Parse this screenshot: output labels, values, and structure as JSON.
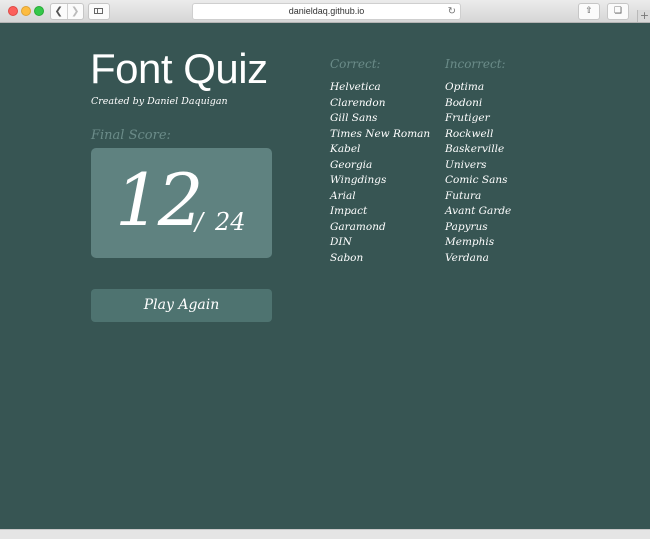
{
  "browser": {
    "url": "danieldaq.github.io"
  },
  "header": {
    "title": "Font Quiz",
    "subtitle": "Created by Daniel Daquigan"
  },
  "score": {
    "label": "Final Score:",
    "value": "12",
    "separator": "/",
    "total": "24"
  },
  "play_again_label": "Play Again",
  "correct": {
    "heading": "Correct:",
    "items": [
      "Helvetica",
      "Clarendon",
      "Gill Sans",
      "Times New Roman",
      "Kabel",
      "Georgia",
      "Wingdings",
      "Arial",
      "Impact",
      "Garamond",
      "DIN",
      "Sabon"
    ]
  },
  "incorrect": {
    "heading": "Incorrect:",
    "items": [
      "Optima",
      "Bodoni",
      "Frutiger",
      "Rockwell",
      "Baskerville",
      "Univers",
      "Comic Sans",
      "Futura",
      "Avant Garde",
      "Papyrus",
      "Memphis",
      "Verdana"
    ]
  },
  "colors": {
    "background": "#375553",
    "score_box": "#5f8280",
    "button": "#4e7370",
    "muted_heading": "#6b8c89"
  }
}
